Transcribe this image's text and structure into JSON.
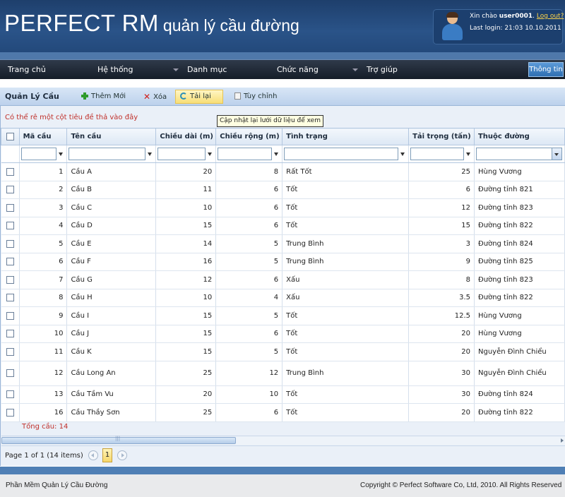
{
  "header": {
    "brand_main": "PERFECT RM",
    "brand_sub": "quản lý cầu đường",
    "greeting_prefix": "Xin chào",
    "username": "user0001",
    "greeting_suffix": ".",
    "logout_label": "Log out?",
    "last_login": "Last login: 21:03 10.10.2011"
  },
  "nav": {
    "items": [
      "Trang chủ",
      "Hệ thống",
      "Danh mục",
      "Chức năng",
      "Trợ giúp"
    ],
    "info_button": "Thông tin"
  },
  "toolbar": {
    "title": "Quản Lý Cầu",
    "add_label": "Thêm Mới",
    "delete_label": "Xóa",
    "reload_label": "Tải lại",
    "customize_label": "Tùy chỉnh",
    "reload_tooltip": "Cập nhật lại lưới dữ liệu để xem"
  },
  "grid": {
    "group_hint": "Có thể rê một cột tiêu đề thả vào đây",
    "columns": [
      "Mã cầu",
      "Tên cầu",
      "Chiều dài (m)",
      "Chiều rộng (m)",
      "Tình trạng",
      "Tải trọng (tấn)",
      "Thuộc đường"
    ],
    "rows": [
      [
        "1",
        "Cầu A",
        "20",
        "8",
        "Rất Tốt",
        "25",
        "Hùng Vương"
      ],
      [
        "2",
        "Cầu B",
        "11",
        "6",
        "Tốt",
        "6",
        "Đường tỉnh 821"
      ],
      [
        "3",
        "Cầu C",
        "10",
        "6",
        "Tốt",
        "12",
        "Đường tỉnh 823"
      ],
      [
        "4",
        "Cầu D",
        "15",
        "6",
        "Tốt",
        "15",
        "Đường tỉnh 822"
      ],
      [
        "5",
        "Cầu E",
        "14",
        "5",
        "Trung Bình",
        "3",
        "Đường tỉnh 824"
      ],
      [
        "6",
        "Cầu F",
        "16",
        "5",
        "Trung Bình",
        "9",
        "Đường tỉnh 825"
      ],
      [
        "7",
        "Cầu G",
        "12",
        "6",
        "Xấu",
        "8",
        "Đường tỉnh 823"
      ],
      [
        "8",
        "Cầu H",
        "10",
        "4",
        "Xấu",
        "3.5",
        "Đường tỉnh 822"
      ],
      [
        "9",
        "Cầu I",
        "15",
        "5",
        "Tốt",
        "12.5",
        "Hùng Vương"
      ],
      [
        "10",
        "Cầu J",
        "15",
        "6",
        "Tốt",
        "20",
        "Hùng Vương"
      ],
      [
        "11",
        "Cầu K",
        "15",
        "5",
        "Tốt",
        "20",
        "Nguyễn Đình Chiểu"
      ],
      [
        "12",
        "Cầu Long An",
        "25",
        "12",
        "Trung Bình",
        "30",
        "Nguyễn Đình Chiểu"
      ],
      [
        "13",
        "Cầu Tầm Vu",
        "20",
        "10",
        "Tốt",
        "30",
        "Đường tỉnh 824"
      ],
      [
        "16",
        "Cầu Thầy Sơn",
        "25",
        "6",
        "Tốt",
        "20",
        "Đường tỉnh 822"
      ]
    ],
    "total": "Tổng cầu: 14"
  },
  "pager": {
    "text": "Page 1 of 1 (14 items)",
    "current_page": "1"
  },
  "footer": {
    "left": "Phần Mềm Quản Lý Cầu Đường",
    "right": "Copyright © Perfect Software Co, Ltd, 2010. All Rights Reserved"
  }
}
